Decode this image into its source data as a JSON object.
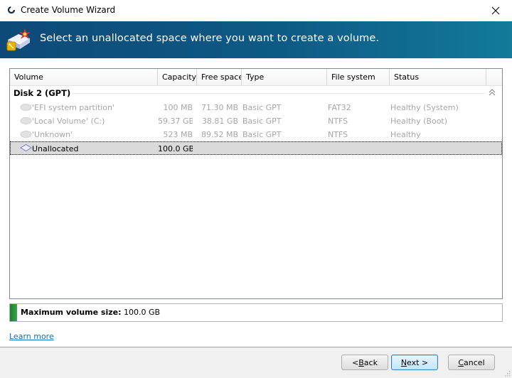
{
  "window": {
    "title": "Create Volume Wizard",
    "icons": {
      "app": "app-logo-icon",
      "close": "close-icon"
    }
  },
  "banner": {
    "heading": "Select an unallocated space where you want to create a volume.",
    "icon": "create-volume-wizard-icon"
  },
  "table": {
    "columns": [
      "Volume",
      "Capacity",
      "Free space",
      "Type",
      "File system",
      "Status"
    ],
    "group": {
      "label": "Disk 2 (GPT)",
      "collapse_icon": "double-chevron-up-icon"
    },
    "rows": [
      {
        "volume": "'EFI system partition'",
        "capacity": "100 MB",
        "free_space": "71.30 MB",
        "type": "Basic GPT",
        "file_system": "FAT32",
        "status": "Healthy (System)",
        "enabled": false,
        "selected": false,
        "icon": "disk-icon"
      },
      {
        "volume": "'Local Volume' (C:)",
        "capacity": "59.37 GB",
        "free_space": "38.81 GB",
        "type": "Basic GPT",
        "file_system": "NTFS",
        "status": "Healthy (Boot)",
        "enabled": false,
        "selected": false,
        "icon": "disk-icon"
      },
      {
        "volume": "'Unknown'",
        "capacity": "523 MB",
        "free_space": "89.52 MB",
        "type": "Basic GPT",
        "file_system": "NTFS",
        "status": "Healthy",
        "enabled": false,
        "selected": false,
        "icon": "disk-icon"
      },
      {
        "volume": "Unallocated",
        "capacity": "100.0 GB",
        "free_space": "",
        "type": "",
        "file_system": "",
        "status": "",
        "enabled": true,
        "selected": true,
        "icon": "unallocated-disk-icon"
      }
    ]
  },
  "max_volume": {
    "label": "Maximum volume size:",
    "value": "100.0 GB",
    "indicator_color": "#2e9a3e"
  },
  "links": {
    "learn_more": "Learn more"
  },
  "buttons": {
    "back": {
      "prefix": "< ",
      "mnemonic": "B",
      "rest": "ack"
    },
    "next": {
      "prefix": "",
      "mnemonic": "N",
      "rest": "ext >"
    },
    "cancel": {
      "prefix": "",
      "mnemonic": "C",
      "rest": "ancel"
    }
  },
  "colors": {
    "banner_start": "#0d4a78",
    "banner_end": "#137a9a",
    "link": "#0b6fc1",
    "selection": "#dadada"
  }
}
